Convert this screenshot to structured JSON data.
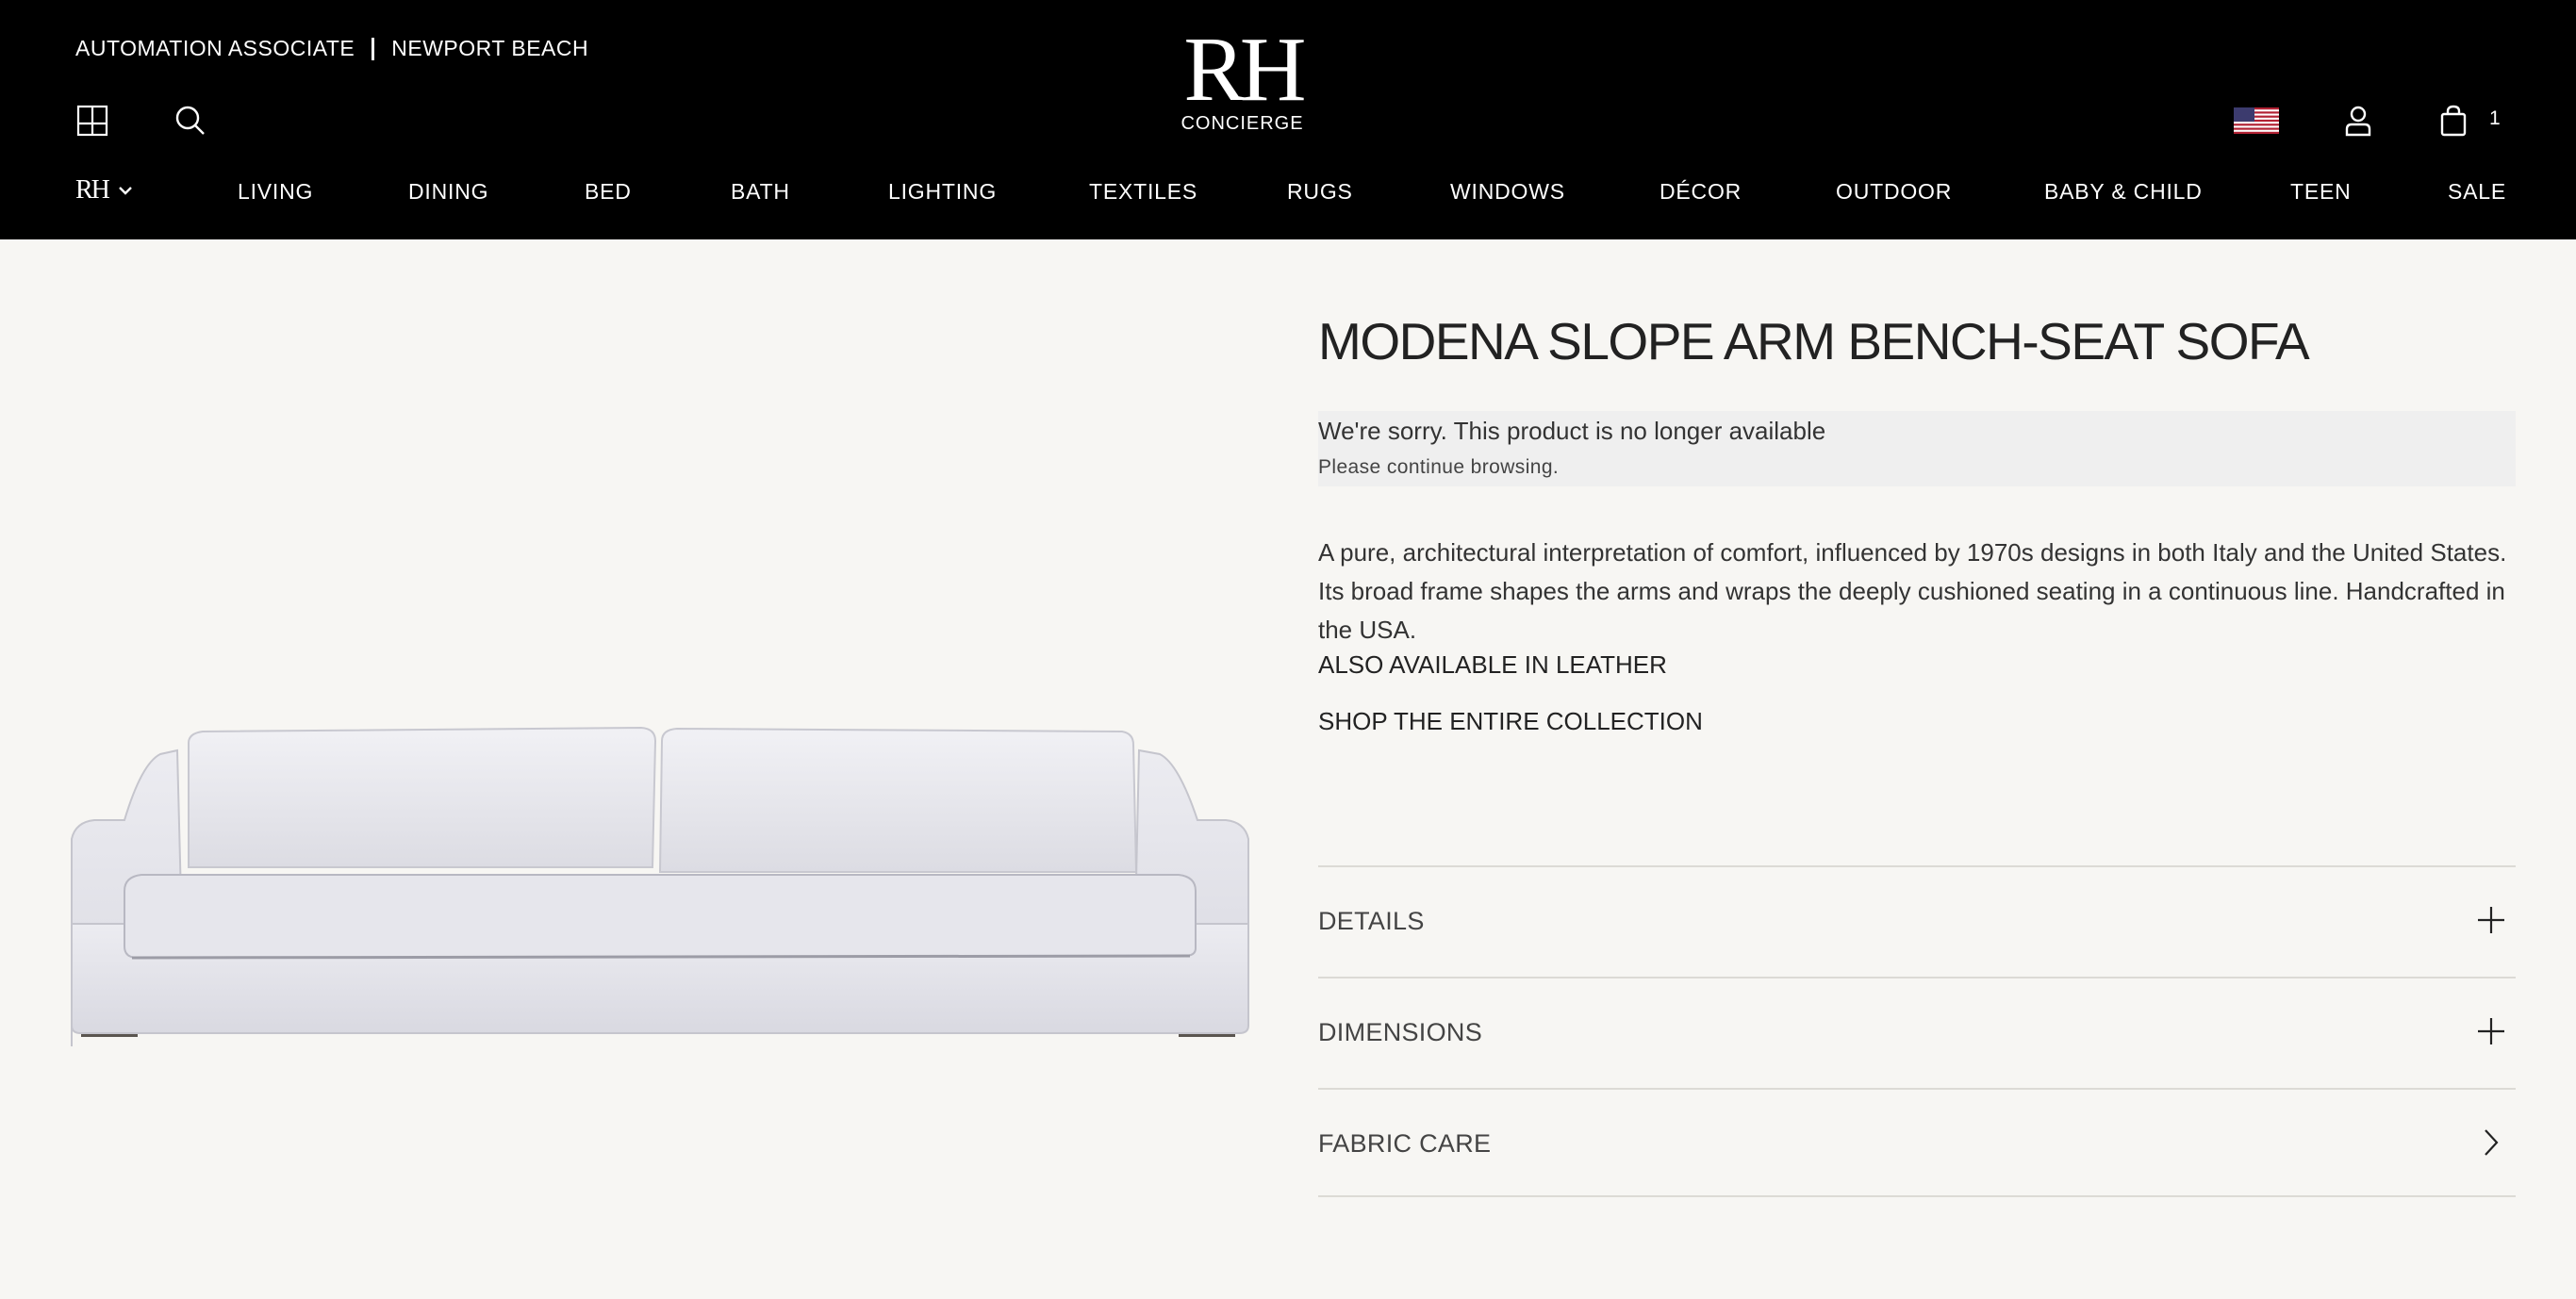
{
  "header": {
    "associate": "AUTOMATION ASSOCIATE",
    "location": "NEWPORT BEACH",
    "logo_mark": "RH",
    "logo_sub": "CONCIERGE",
    "mini_logo": "RH",
    "cart_count": "1",
    "icons": [
      "gallery-icon",
      "search-icon",
      "us-flag-icon",
      "account-icon",
      "cart-icon",
      "chevron-down-icon"
    ]
  },
  "nav": {
    "items": [
      "LIVING",
      "DINING",
      "BED",
      "BATH",
      "LIGHTING",
      "TEXTILES",
      "RUGS",
      "WINDOWS",
      "DÉCOR",
      "OUTDOOR",
      "BABY & CHILD",
      "TEEN",
      "SALE"
    ]
  },
  "product": {
    "title": "MODENA SLOPE ARM BENCH-SEAT SOFA",
    "notice_title": "We're sorry. This product is no longer available",
    "notice_sub": "Please continue browsing.",
    "description": "A pure, architectural interpretation of comfort, influenced by 1970s designs in both Italy and the United States. Its broad frame shapes the arms and wraps the deeply cushioned seating in a continuous line. Handcrafted in the USA.",
    "link_leather": "ALSO AVAILABLE IN LEATHER",
    "link_collection": "SHOP THE ENTIRE COLLECTION",
    "accordions": [
      {
        "label": "DETAILS",
        "icon": "plus-icon"
      },
      {
        "label": "DIMENSIONS",
        "icon": "plus-icon"
      },
      {
        "label": "FABRIC CARE",
        "icon": "chevron-right-icon"
      }
    ]
  },
  "colors": {
    "header_bg": "#000000",
    "page_bg": "#f7f6f3",
    "notice_bg": "#efefef",
    "divider": "#dcdad5"
  }
}
